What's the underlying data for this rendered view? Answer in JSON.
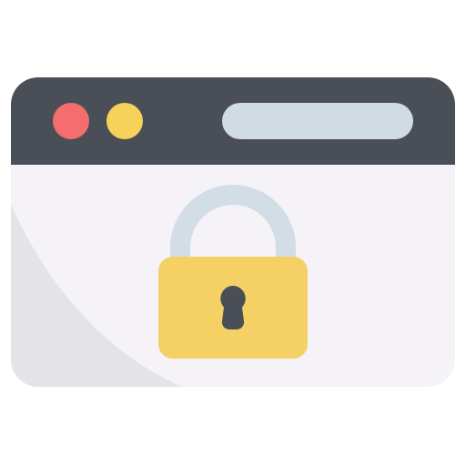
{
  "illustration": {
    "subject": "browser-window-with-padlock",
    "icons": [
      "browser-window-icon",
      "padlock-icon",
      "keyhole-icon"
    ]
  },
  "colors": {
    "frame": "#4a4f57",
    "window_body": "#f5f3f8",
    "window_shadow": "#e4e3e8",
    "dot_red": "#f56d6c",
    "dot_yellow": "#f6d25a",
    "address_bar": "#d0dbe4",
    "shackle": "#d3dde6",
    "lock_body": "#f4d065",
    "keyhole": "#4a4f57"
  }
}
